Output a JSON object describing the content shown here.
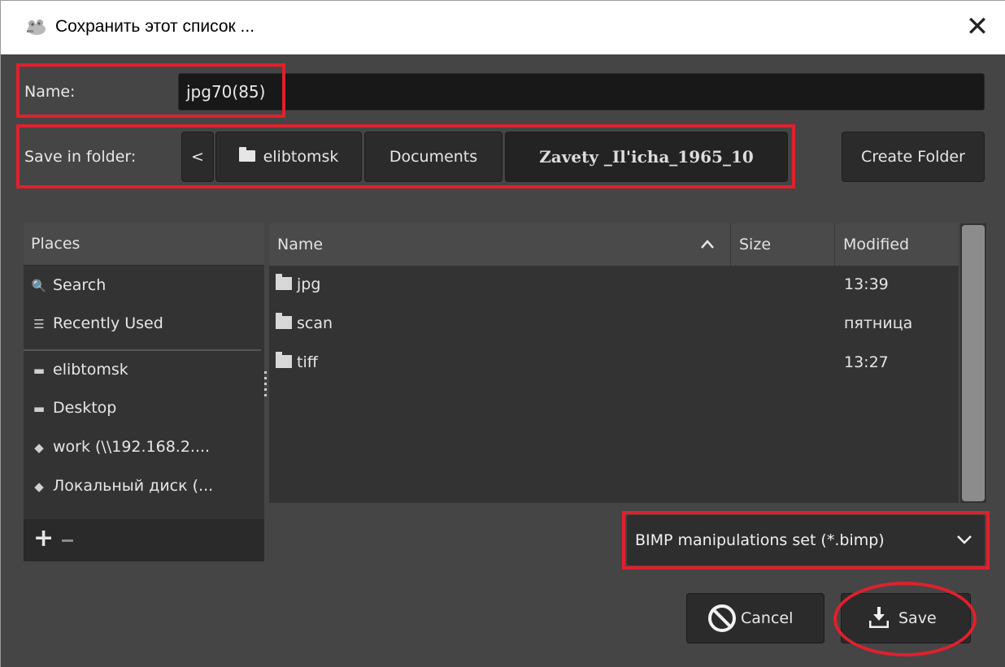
{
  "window": {
    "title": "Сохранить этот список ...",
    "close_glyph": "✕"
  },
  "name_row": {
    "label": "Name:",
    "value": "jpg70(85)"
  },
  "folder_row": {
    "label": "Save in folder:",
    "back_glyph": "<",
    "path": [
      "elibtomsk",
      "Documents",
      "Zavety _Il'icha_1965_10"
    ],
    "create_folder": "Create Folder"
  },
  "places": {
    "header": "Places",
    "items": [
      {
        "label": "Search",
        "icon": "search-icon"
      },
      {
        "label": "Recently Used",
        "icon": "recent-icon"
      },
      {
        "label": "elibtomsk",
        "icon": "folder-icon"
      },
      {
        "label": "Desktop",
        "icon": "folder-icon"
      },
      {
        "label": "work (\\\\192.168.2....",
        "icon": "network-drive-icon"
      },
      {
        "label": "Локальный диск (...",
        "icon": "local-disk-icon"
      }
    ],
    "add_glyph": "+"
  },
  "files": {
    "columns": [
      "Name",
      "Size",
      "Modified"
    ],
    "sort_glyph": "^",
    "rows": [
      {
        "name": "jpg",
        "modified": "13:39"
      },
      {
        "name": "scan",
        "modified": "пятница"
      },
      {
        "name": "tiff",
        "modified": "13:27"
      }
    ]
  },
  "filter": {
    "selected": "BIMP manipulations set (*.bimp)",
    "chevron": "⌄"
  },
  "buttons": {
    "cancel": "Cancel",
    "save": "Save"
  },
  "colors": {
    "background": "#454545",
    "highlight": "#e0202d"
  }
}
